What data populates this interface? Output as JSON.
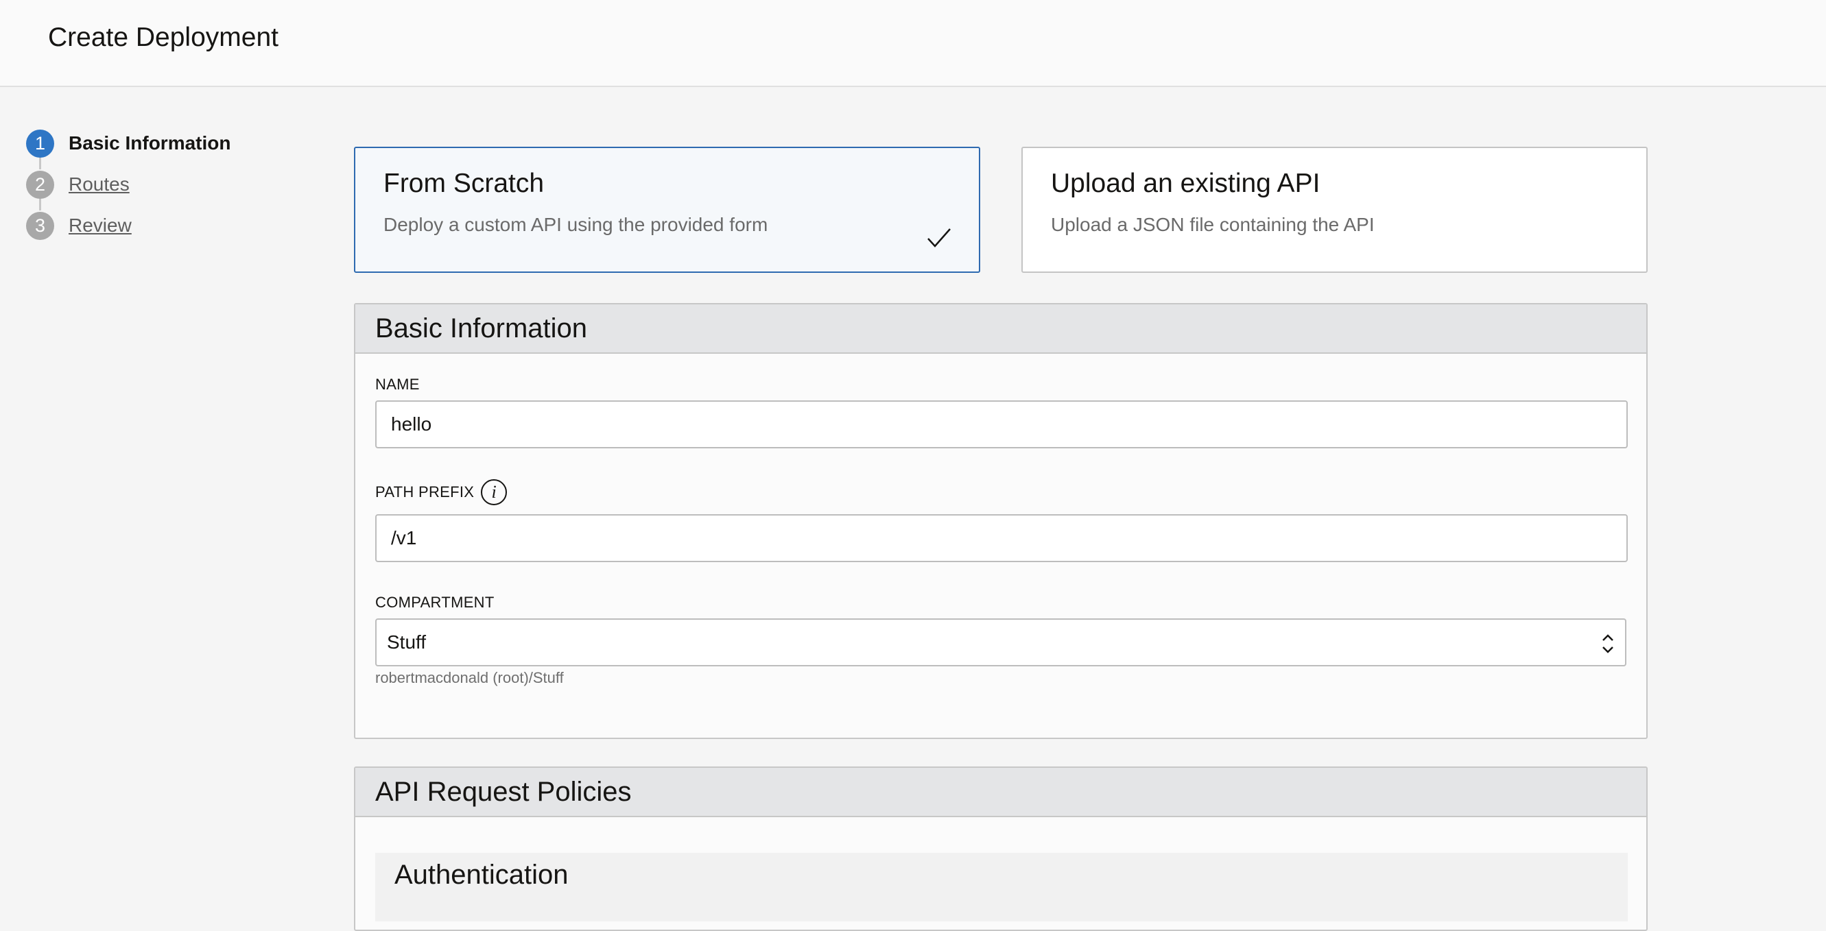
{
  "header": {
    "title": "Create Deployment"
  },
  "steps": [
    {
      "number": "1",
      "label": "Basic Information",
      "active": true
    },
    {
      "number": "2",
      "label": "Routes",
      "active": false
    },
    {
      "number": "3",
      "label": "Review",
      "active": false
    }
  ],
  "options": {
    "scratch": {
      "title": "From Scratch",
      "description": "Deploy a custom API using the provided form",
      "selected": true
    },
    "upload": {
      "title": "Upload an existing API",
      "description": "Upload a JSON file containing the API",
      "selected": false
    }
  },
  "basic_info": {
    "title": "Basic Information",
    "name_label": "NAME",
    "name_value": "hello",
    "path_prefix_label": "PATH PREFIX",
    "path_prefix_value": "/v1",
    "compartment_label": "COMPARTMENT",
    "compartment_value": "Stuff",
    "compartment_path": "robertmacdonald (root)/Stuff"
  },
  "policies": {
    "title": "API Request Policies",
    "authentication_title": "Authentication"
  },
  "colors": {
    "accent": "#2e76c5",
    "selected_border": "#2e6ab0",
    "panel_header": "#e4e5e7"
  },
  "icons": {
    "check": "checkmark-icon",
    "info": "info-icon",
    "select_arrows": "chevron-updown-icon"
  }
}
